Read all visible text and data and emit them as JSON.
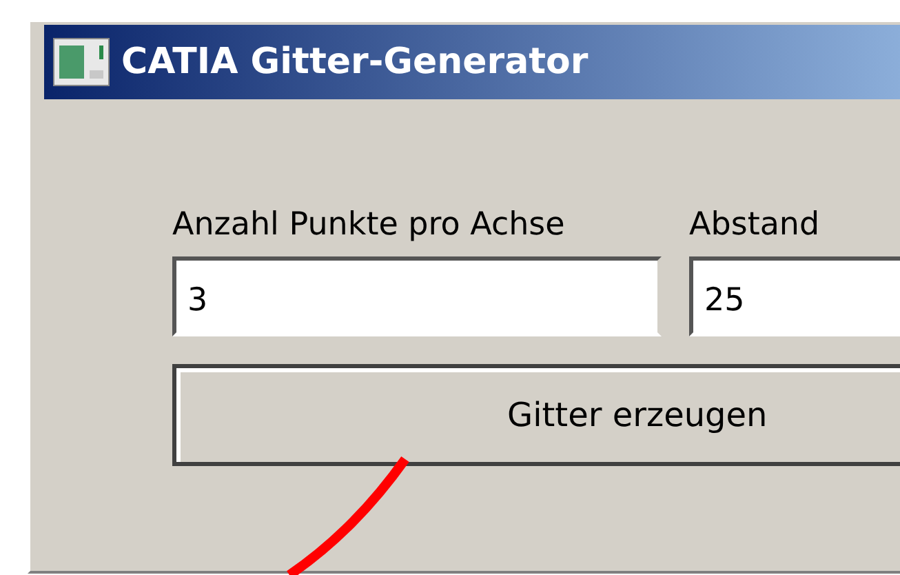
{
  "window": {
    "title": "CATIA Gitter-Generator"
  },
  "fields": [
    {
      "label": "Anzahl Punkte pro Achse",
      "value": "3"
    },
    {
      "label": "Abstand",
      "value": "25"
    }
  ],
  "button": {
    "label": "Gitter erzeugen"
  }
}
